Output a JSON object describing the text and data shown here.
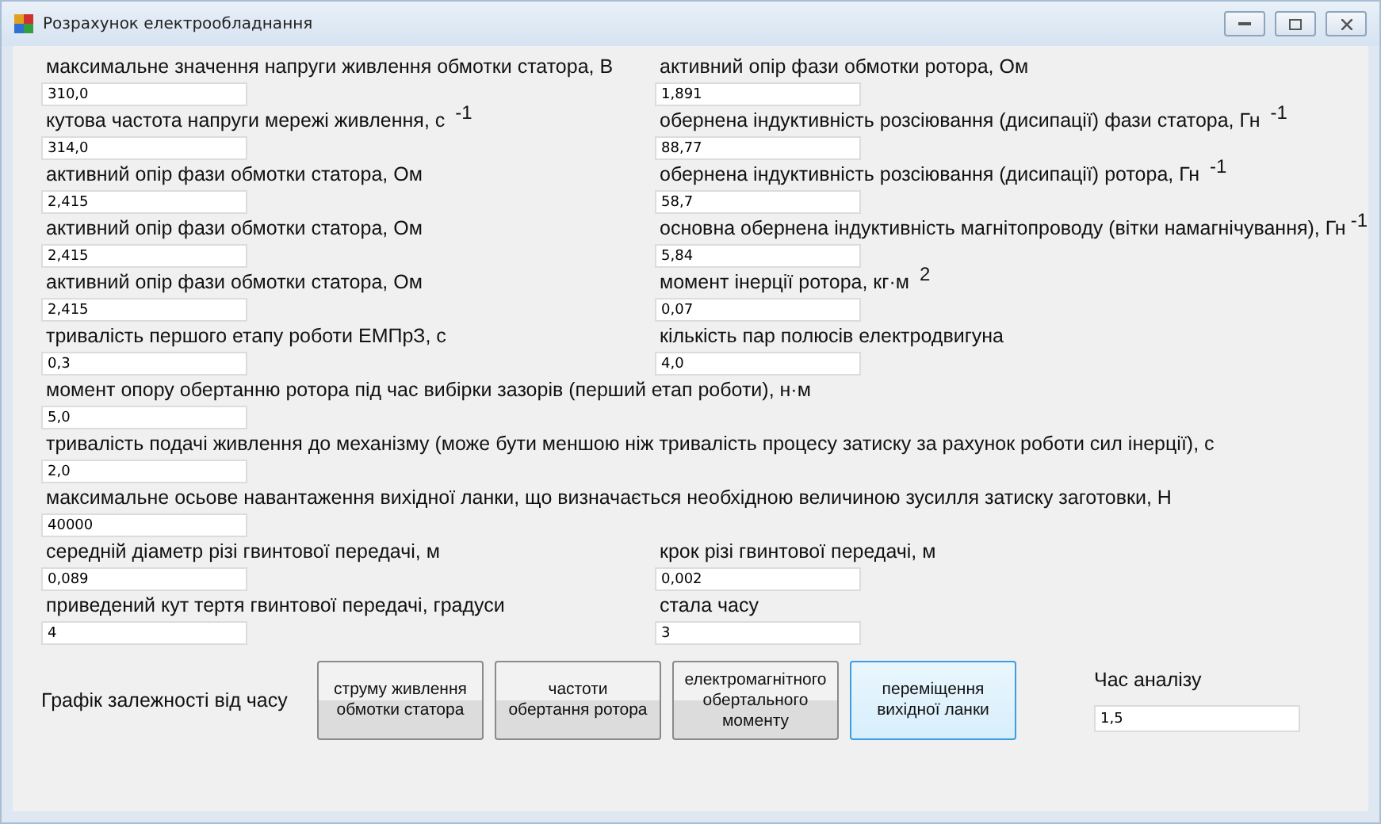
{
  "window": {
    "title": "Розрахунок електрообладнання"
  },
  "rows": [
    {
      "kind": "pair",
      "fields": [
        {
          "label": "максимальне значення напруги живлення обмотки статора, В",
          "value": "310,0"
        },
        {
          "label": "активний опір фази обмотки ротора, Ом",
          "value": "1,891"
        }
      ]
    },
    {
      "kind": "pair",
      "fields": [
        {
          "label": "кутова частота напруги мережі живлення, с $^{-1}$",
          "value": "314,0"
        },
        {
          "label": "обернена індуктивність розсіювання (дисипації) фази статора, Гн $^{-1}$",
          "value": "88,77"
        }
      ]
    },
    {
      "kind": "pair",
      "fields": [
        {
          "label": "активний опір фази обмотки статора, Ом",
          "value": "2,415"
        },
        {
          "label": "обернена індуктивність розсіювання (дисипації) ротора, Гн $^{-1}$",
          "value": "58,7"
        }
      ]
    },
    {
      "kind": "pair",
      "fields": [
        {
          "label": "активний опір фази обмотки статора, Ом",
          "value": "2,415"
        },
        {
          "label": "основна обернена індуктивність магнітопроводу (вітки намагнічування), Гн$^{-1}$",
          "value": "5,84"
        }
      ]
    },
    {
      "kind": "pair",
      "fields": [
        {
          "label": "активний опір фази обмотки статора, Ом",
          "value": "2,415"
        },
        {
          "label": "момент інерції ротора, кг·м $^{2}$",
          "value": "0,07"
        }
      ]
    },
    {
      "kind": "pair",
      "fields": [
        {
          "label": "тривалість першого етапу роботи ЕМПрЗ, с",
          "value": "0,3"
        },
        {
          "label": "кількість пар полюсів електродвигуна",
          "value": "4,0"
        }
      ]
    },
    {
      "kind": "wide",
      "fields": [
        {
          "label": "момент опору обертанню ротора під час вибірки зазорів (перший етап роботи), н·м",
          "value": "5,0"
        }
      ]
    },
    {
      "kind": "wide",
      "fields": [
        {
          "label": "тривалість подачі живлення до механізму (може бути меншою ніж тривалість процесу затиску за рахунок роботи сил інерції), с",
          "value": "2,0"
        }
      ]
    },
    {
      "kind": "wide",
      "fields": [
        {
          "label": "максимальне осьове навантаження вихідної ланки, що визначається необхідною величиною зусилля затиску заготовки, Н",
          "value": "40000"
        }
      ]
    },
    {
      "kind": "pair",
      "fields": [
        {
          "label": "середній діаметр різі гвинтової передачі, м",
          "value": "0,089"
        },
        {
          "label": "крок різі гвинтової передачі, м",
          "value": "0,002"
        }
      ]
    },
    {
      "kind": "pair",
      "fields": [
        {
          "label": "приведений кут тертя гвинтової передачі, градуси",
          "value": "4"
        },
        {
          "label": "стала часу",
          "value": "3"
        }
      ]
    }
  ],
  "chart_label": "Графік залежності від часу",
  "buttons": [
    {
      "label": "струму живлення обмотки статора",
      "focused": false
    },
    {
      "label": "частоти обертання ротора",
      "focused": false
    },
    {
      "label": "електромагнітного обертального моменту",
      "focused": false
    },
    {
      "label": "переміщення вихідної ланки",
      "focused": true
    }
  ],
  "analysis_time": {
    "label": "Час аналізу",
    "value": "1,5"
  }
}
